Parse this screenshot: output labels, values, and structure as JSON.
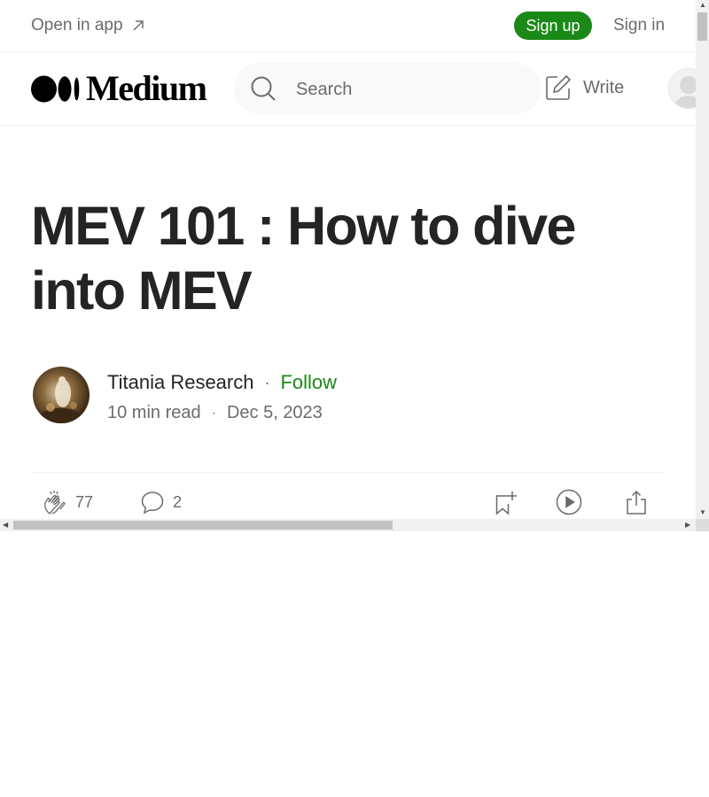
{
  "banner": {
    "open_in_app": "Open in app",
    "sign_up": "Sign up",
    "sign_in": "Sign in"
  },
  "nav": {
    "logo_text": "Medium",
    "search_placeholder": "Search",
    "write": "Write"
  },
  "article": {
    "title": "MEV 101 : How to dive into MEV",
    "author": "Titania Research",
    "follow": "Follow",
    "read_time": "10 min read",
    "date": "Dec 5, 2023",
    "claps": "77",
    "responses": "2"
  },
  "colors": {
    "accent_green": "#1a8917",
    "text_primary": "#242424",
    "text_secondary": "#6b6b6b"
  },
  "icons": {
    "open_app": "arrow-up-right-icon",
    "search": "search-icon",
    "write": "edit-icon",
    "clap": "clap-icon",
    "responses": "comment-icon",
    "save": "bookmark-add-icon",
    "listen": "play-icon",
    "share": "share-icon"
  }
}
